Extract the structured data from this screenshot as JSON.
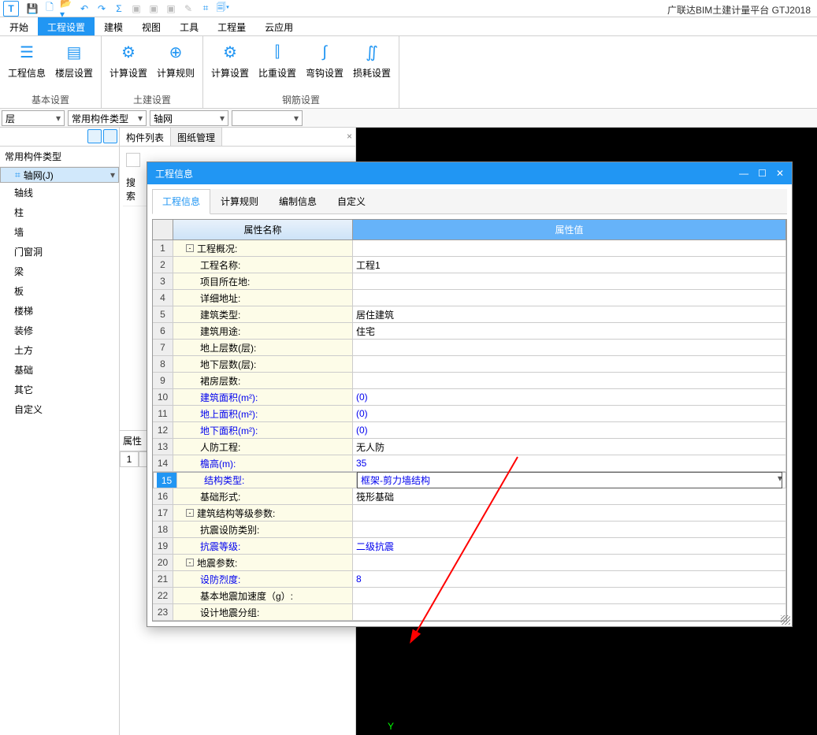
{
  "app_title": "广联达BIM土建计量平台 GTJ2018",
  "qat_logo": "T",
  "menu_tabs": [
    "开始",
    "工程设置",
    "建模",
    "视图",
    "工具",
    "工程量",
    "云应用"
  ],
  "menu_active_idx": 1,
  "ribbon": {
    "groups": [
      {
        "title": "基本设置",
        "btns": [
          {
            "label": "工程信息",
            "icon": "☰"
          },
          {
            "label": "楼层设置",
            "icon": "▤"
          }
        ]
      },
      {
        "title": "土建设置",
        "btns": [
          {
            "label": "计算设置",
            "icon": "⚙"
          },
          {
            "label": "计算规则",
            "icon": "⊕"
          }
        ]
      },
      {
        "title": "钢筋设置",
        "btns": [
          {
            "label": "计算设置",
            "icon": "⚙"
          },
          {
            "label": "比重设置",
            "icon": "⫿"
          },
          {
            "label": "弯钩设置",
            "icon": "∫"
          },
          {
            "label": "损耗设置",
            "icon": "∬"
          }
        ]
      }
    ]
  },
  "selectors": [
    {
      "value": "层",
      "w": 80
    },
    {
      "value": "常用构件类型",
      "w": 100
    },
    {
      "value": "轴网",
      "w": 100
    },
    {
      "value": "",
      "w": 90
    }
  ],
  "left_tree": {
    "header": "常用构件类型",
    "items": [
      {
        "label": "轴网(J)",
        "sel": true,
        "icon": "⌗"
      },
      {
        "label": "轴线"
      },
      {
        "label": "柱"
      },
      {
        "label": "墙"
      },
      {
        "label": "门窗洞"
      },
      {
        "label": "梁"
      },
      {
        "label": "板"
      },
      {
        "label": "楼梯"
      },
      {
        "label": "装修"
      },
      {
        "label": "土方"
      },
      {
        "label": "基础"
      },
      {
        "label": "其它"
      },
      {
        "label": "自定义"
      }
    ]
  },
  "mid_tabs": [
    "构件列表",
    "图纸管理"
  ],
  "mid_active_idx": 0,
  "search_label": "搜索",
  "prop_label": "属性",
  "prop_row_num": "1",
  "canvas_axis_y": "Y",
  "dialog": {
    "title": "工程信息",
    "tabs": [
      "工程信息",
      "计算规则",
      "编制信息",
      "自定义"
    ],
    "active_tab": 0,
    "col_name_hdr": "属性名称",
    "col_val_hdr": "属性值",
    "rows": [
      {
        "n": 1,
        "indent": 0,
        "exp": "-",
        "name": "工程概况:",
        "val": "",
        "blue": false,
        "hdr": true
      },
      {
        "n": 2,
        "indent": 1,
        "name": "工程名称:",
        "val": "工程1"
      },
      {
        "n": 3,
        "indent": 1,
        "name": "项目所在地:",
        "val": ""
      },
      {
        "n": 4,
        "indent": 1,
        "name": "详细地址:",
        "val": ""
      },
      {
        "n": 5,
        "indent": 1,
        "name": "建筑类型:",
        "val": "居住建筑"
      },
      {
        "n": 6,
        "indent": 1,
        "name": "建筑用途:",
        "val": "住宅"
      },
      {
        "n": 7,
        "indent": 1,
        "name": "地上层数(层):",
        "val": ""
      },
      {
        "n": 8,
        "indent": 1,
        "name": "地下层数(层):",
        "val": ""
      },
      {
        "n": 9,
        "indent": 1,
        "name": "裙房层数:",
        "val": ""
      },
      {
        "n": 10,
        "indent": 1,
        "name": "建筑面积(m²):",
        "val": "(0)",
        "blue": true
      },
      {
        "n": 11,
        "indent": 1,
        "name": "地上面积(m²):",
        "val": "(0)",
        "blue": true
      },
      {
        "n": 12,
        "indent": 1,
        "name": "地下面积(m²):",
        "val": "(0)",
        "blue": true
      },
      {
        "n": 13,
        "indent": 1,
        "name": "人防工程:",
        "val": "无人防"
      },
      {
        "n": 14,
        "indent": 1,
        "name": "檐高(m):",
        "val": "35",
        "blue": true
      },
      {
        "n": 15,
        "indent": 1,
        "name": "结构类型:",
        "val": "框架-剪力墙结构",
        "blue": true,
        "sel": true
      },
      {
        "n": 16,
        "indent": 1,
        "name": "基础形式:",
        "val": "筏形基础"
      },
      {
        "n": 17,
        "indent": 0,
        "exp": "-",
        "name": "建筑结构等级参数:",
        "val": "",
        "hdr": true
      },
      {
        "n": 18,
        "indent": 1,
        "name": "抗震设防类别:",
        "val": ""
      },
      {
        "n": 19,
        "indent": 1,
        "name": "抗震等级:",
        "val": "二级抗震",
        "blue": true
      },
      {
        "n": 20,
        "indent": 0,
        "exp": "-",
        "name": "地震参数:",
        "val": "",
        "hdr": true
      },
      {
        "n": 21,
        "indent": 1,
        "name": "设防烈度:",
        "val": "8",
        "blue": true
      },
      {
        "n": 22,
        "indent": 1,
        "name": "基本地震加速度（g）:",
        "val": ""
      },
      {
        "n": 23,
        "indent": 1,
        "name": "设计地震分组:",
        "val": ""
      }
    ]
  }
}
